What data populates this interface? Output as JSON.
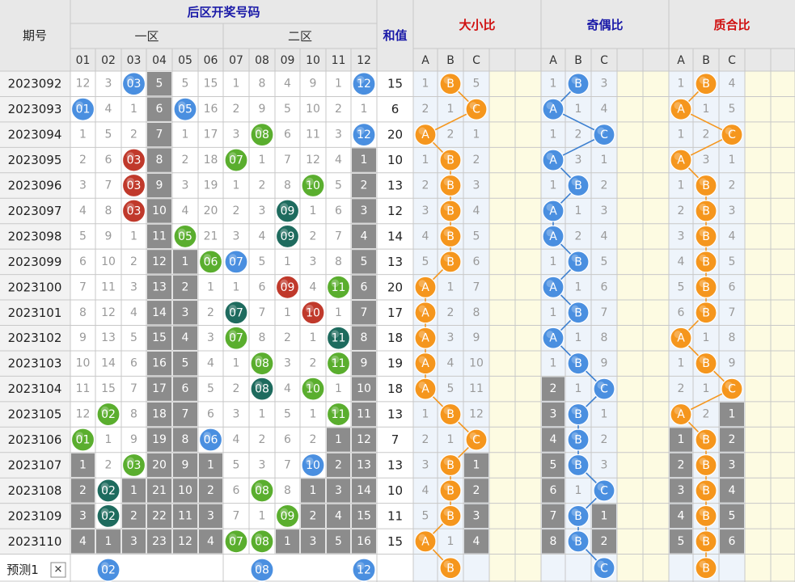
{
  "header": {
    "period_label": "期号",
    "back_zone_title": "后区开奖号码",
    "zone1_label": "一区",
    "zone2_label": "二区",
    "sum_label": "和值",
    "size_ratio_label": "大小比",
    "odd_even_label": "奇偶比",
    "prime_ratio_label": "质合比",
    "number_columns": [
      "01",
      "02",
      "03",
      "04",
      "05",
      "06",
      "07",
      "08",
      "09",
      "10",
      "11",
      "12"
    ],
    "abc": [
      "A",
      "B",
      "C"
    ]
  },
  "footer": {
    "predict_label": "预测1",
    "close_glyph": "✕",
    "predicted_numbers": [
      "02",
      "08",
      "12"
    ],
    "predicted_size": "B",
    "predicted_odd_even": "C",
    "predicted_prime": "B"
  },
  "colors": {
    "header_bg": "#e8e8e8",
    "grid_line": "#c8c8c8",
    "cell_highlight_cream": "#fdfbe2",
    "cell_highlight_blue": "#eef4fb",
    "repeat_box": "#8c8c8c",
    "ball_blue": "#4a8fe0",
    "ball_red": "#c0392b",
    "ball_green": "#5aae2e",
    "ball_teal": "#1e6b5e",
    "ball_orange": "#f5961d",
    "title_blue": "#1a1aa8",
    "title_red": "#d01010"
  },
  "chart_data": {
    "type": "table",
    "rows": [
      {
        "period": "2023092",
        "nums": [
          "12",
          "3",
          "03",
          "5",
          "5",
          "15",
          "1",
          "8",
          "4",
          "9",
          "1",
          "12"
        ],
        "sum": "15",
        "size": [
          "1",
          "B",
          "5"
        ],
        "oe": [
          "1",
          "B",
          "3"
        ],
        "prime": [
          "1",
          "B",
          "4"
        ]
      },
      {
        "period": "2023093",
        "nums": [
          "01",
          "4",
          "1",
          "6",
          "05",
          "16",
          "2",
          "9",
          "5",
          "10",
          "2",
          "1"
        ],
        "sum": "6",
        "size": [
          "2",
          "1",
          "C"
        ],
        "oe": [
          "A",
          "1",
          "4"
        ],
        "prime": [
          "A",
          "1",
          "5"
        ]
      },
      {
        "period": "2023094",
        "nums": [
          "1",
          "5",
          "2",
          "7",
          "1",
          "17",
          "3",
          "08",
          "6",
          "11",
          "3",
          "12"
        ],
        "sum": "20",
        "size": [
          "A",
          "2",
          "1"
        ],
        "oe": [
          "1",
          "2",
          "C"
        ],
        "prime": [
          "1",
          "2",
          "C"
        ]
      },
      {
        "period": "2023095",
        "nums": [
          "2",
          "6",
          "03",
          "8",
          "2",
          "18",
          "07",
          "1",
          "7",
          "12",
          "4",
          "1"
        ],
        "sum": "10",
        "size": [
          "1",
          "B",
          "2"
        ],
        "oe": [
          "A",
          "3",
          "1"
        ],
        "prime": [
          "A",
          "3",
          "1"
        ]
      },
      {
        "period": "2023096",
        "nums": [
          "3",
          "7",
          "03",
          "9",
          "3",
          "19",
          "1",
          "2",
          "8",
          "10",
          "5",
          "2"
        ],
        "sum": "13",
        "size": [
          "2",
          "B",
          "3"
        ],
        "oe": [
          "1",
          "B",
          "2"
        ],
        "prime": [
          "1",
          "B",
          "2"
        ]
      },
      {
        "period": "2023097",
        "nums": [
          "4",
          "8",
          "03",
          "10",
          "4",
          "20",
          "2",
          "3",
          "09",
          "1",
          "6",
          "3"
        ],
        "sum": "12",
        "size": [
          "3",
          "B",
          "4"
        ],
        "oe": [
          "A",
          "1",
          "3"
        ],
        "prime": [
          "2",
          "B",
          "3"
        ]
      },
      {
        "period": "2023098",
        "nums": [
          "5",
          "9",
          "1",
          "11",
          "05",
          "21",
          "3",
          "4",
          "09",
          "2",
          "7",
          "4"
        ],
        "sum": "14",
        "size": [
          "4",
          "B",
          "5"
        ],
        "oe": [
          "A",
          "2",
          "4"
        ],
        "prime": [
          "3",
          "B",
          "4"
        ]
      },
      {
        "period": "2023099",
        "nums": [
          "6",
          "10",
          "2",
          "12",
          "1",
          "06",
          "07",
          "5",
          "1",
          "3",
          "8",
          "5"
        ],
        "sum": "13",
        "size": [
          "5",
          "B",
          "6"
        ],
        "oe": [
          "1",
          "B",
          "5"
        ],
        "prime": [
          "4",
          "B",
          "5"
        ]
      },
      {
        "period": "2023100",
        "nums": [
          "7",
          "11",
          "3",
          "13",
          "2",
          "1",
          "1",
          "6",
          "09",
          "4",
          "11",
          "6"
        ],
        "sum": "20",
        "size": [
          "A",
          "1",
          "7"
        ],
        "oe": [
          "A",
          "1",
          "6"
        ],
        "prime": [
          "5",
          "B",
          "6"
        ]
      },
      {
        "period": "2023101",
        "nums": [
          "8",
          "12",
          "4",
          "14",
          "3",
          "2",
          "07",
          "7",
          "1",
          "10",
          "1",
          "7"
        ],
        "sum": "17",
        "size": [
          "A",
          "2",
          "8"
        ],
        "oe": [
          "1",
          "B",
          "7"
        ],
        "prime": [
          "6",
          "B",
          "7"
        ]
      },
      {
        "period": "2023102",
        "nums": [
          "9",
          "13",
          "5",
          "15",
          "4",
          "3",
          "07",
          "8",
          "2",
          "1",
          "11",
          "8"
        ],
        "sum": "18",
        "size": [
          "A",
          "3",
          "9"
        ],
        "oe": [
          "A",
          "1",
          "8"
        ],
        "prime": [
          "A",
          "1",
          "8"
        ]
      },
      {
        "period": "2023103",
        "nums": [
          "10",
          "14",
          "6",
          "16",
          "5",
          "4",
          "1",
          "08",
          "3",
          "2",
          "11",
          "9"
        ],
        "sum": "19",
        "size": [
          "A",
          "4",
          "10"
        ],
        "oe": [
          "1",
          "B",
          "9"
        ],
        "prime": [
          "1",
          "B",
          "9"
        ]
      },
      {
        "period": "2023104",
        "nums": [
          "11",
          "15",
          "7",
          "17",
          "6",
          "5",
          "2",
          "08",
          "4",
          "10",
          "1",
          "10"
        ],
        "sum": "18",
        "size": [
          "A",
          "5",
          "11"
        ],
        "oe": [
          "2",
          "1",
          "C"
        ],
        "prime": [
          "2",
          "1",
          "C"
        ]
      },
      {
        "period": "2023105",
        "nums": [
          "12",
          "02",
          "8",
          "18",
          "7",
          "6",
          "3",
          "1",
          "5",
          "1",
          "11",
          "11"
        ],
        "sum": "13",
        "size": [
          "1",
          "B",
          "12"
        ],
        "oe": [
          "3",
          "B",
          "1"
        ],
        "prime": [
          "A",
          "2",
          "1"
        ]
      },
      {
        "period": "2023106",
        "nums": [
          "01",
          "1",
          "9",
          "19",
          "8",
          "06",
          "4",
          "2",
          "6",
          "2",
          "1",
          "12"
        ],
        "sum": "7",
        "size": [
          "2",
          "1",
          "C"
        ],
        "oe": [
          "4",
          "B",
          "2"
        ],
        "prime": [
          "1",
          "B",
          "2"
        ]
      },
      {
        "period": "2023107",
        "nums": [
          "1",
          "2",
          "03",
          "20",
          "9",
          "1",
          "5",
          "3",
          "7",
          "10",
          "2",
          "13"
        ],
        "sum": "13",
        "size": [
          "3",
          "B",
          "1"
        ],
        "oe": [
          "5",
          "B",
          "3"
        ],
        "prime": [
          "2",
          "B",
          "3"
        ]
      },
      {
        "period": "2023108",
        "nums": [
          "2",
          "02",
          "1",
          "21",
          "10",
          "2",
          "6",
          "08",
          "8",
          "1",
          "3",
          "14"
        ],
        "sum": "10",
        "size": [
          "4",
          "B",
          "2"
        ],
        "oe": [
          "6",
          "1",
          "C"
        ],
        "prime": [
          "3",
          "B",
          "4"
        ]
      },
      {
        "period": "2023109",
        "nums": [
          "3",
          "02",
          "2",
          "22",
          "11",
          "3",
          "7",
          "1",
          "09",
          "2",
          "4",
          "15"
        ],
        "sum": "11",
        "size": [
          "5",
          "B",
          "3"
        ],
        "oe": [
          "7",
          "B",
          "1"
        ],
        "prime": [
          "4",
          "B",
          "5"
        ]
      },
      {
        "period": "2023110",
        "nums": [
          "4",
          "1",
          "3",
          "23",
          "12",
          "4",
          "07",
          "08",
          "1",
          "3",
          "5",
          "16"
        ],
        "sum": "15",
        "size": [
          "A",
          "1",
          "4"
        ],
        "oe": [
          "8",
          "B",
          "2"
        ],
        "prime": [
          "5",
          "B",
          "6"
        ]
      }
    ]
  }
}
